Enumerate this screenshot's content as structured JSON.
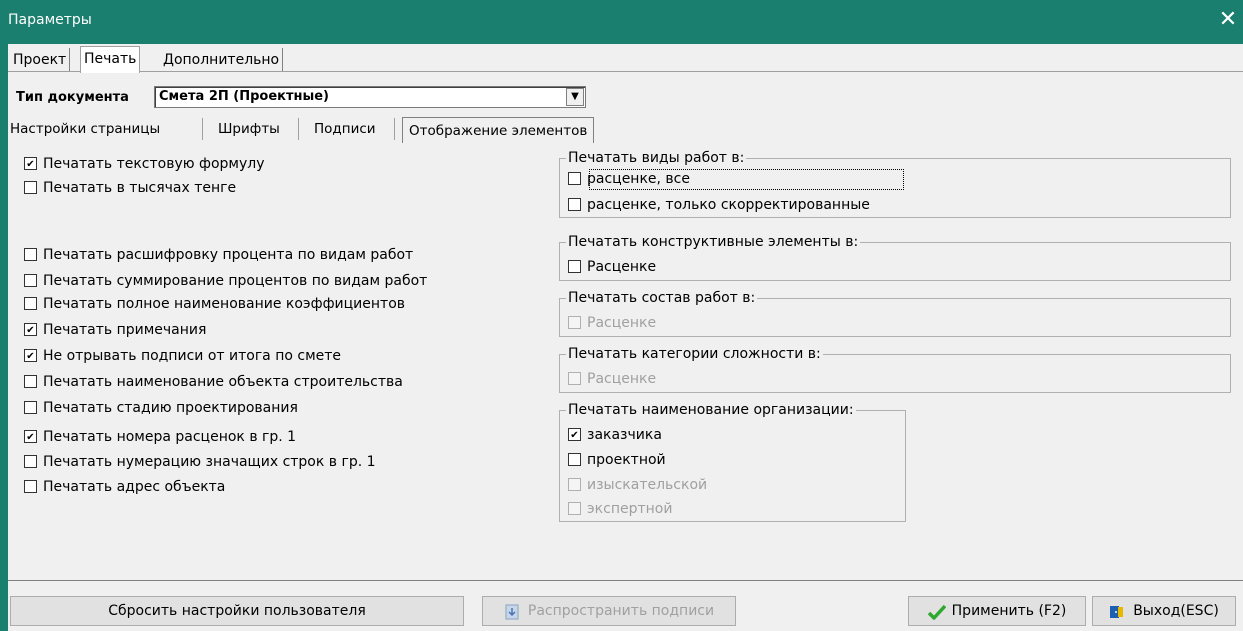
{
  "window": {
    "title": "Параметры",
    "close_icon": "close-icon"
  },
  "main_tabs": [
    "Проект",
    "Печать",
    "Дополнительно"
  ],
  "doc_type": {
    "label": "Тип документа",
    "value": "Смета 2П (Проектные)"
  },
  "sub_tabs": [
    "Настройки страницы",
    "Шрифты",
    "Подписи",
    "Отображение элементов"
  ],
  "left_options": [
    {
      "label": "Печатать текстовую формулу",
      "checked": true
    },
    {
      "label": "Печатать в тысячах тенге",
      "checked": false
    },
    {
      "label": "Печатать расшифровку процента по видам работ",
      "checked": false
    },
    {
      "label": "Печатать суммирование процентов по видам работ",
      "checked": false
    },
    {
      "label": "Печатать полное наименование коэффициентов",
      "checked": false
    },
    {
      "label": "Печатать примечания",
      "checked": true
    },
    {
      "label": "Не отрывать подписи от итога по смете",
      "checked": true
    },
    {
      "label": "Печатать наименование объекта строительства",
      "checked": false
    },
    {
      "label": "Печатать стадию проектирования",
      "checked": false
    },
    {
      "label": "Печатать номера расценок в гр. 1",
      "checked": true
    },
    {
      "label": "Печатать нумерацию значащих строк в гр. 1",
      "checked": false
    },
    {
      "label": "Печатать адрес объекта",
      "checked": false
    }
  ],
  "groups": {
    "work_types": {
      "title": "Печатать виды работ в:",
      "items": [
        {
          "label": "расценке, все",
          "checked": false,
          "disabled": false
        },
        {
          "label": "расценке, только скорректированные",
          "checked": false,
          "disabled": false
        }
      ]
    },
    "structural": {
      "title": "Печатать конструктивные элементы в:",
      "items": [
        {
          "label": "Расценке",
          "checked": false,
          "disabled": false
        }
      ]
    },
    "composition": {
      "title": "Печатать состав работ в:",
      "items": [
        {
          "label": "Расценке",
          "checked": false,
          "disabled": true
        }
      ]
    },
    "complexity": {
      "title": "Печатать категории сложности в:",
      "items": [
        {
          "label": "Расценке",
          "checked": false,
          "disabled": true
        }
      ]
    },
    "organization": {
      "title": "Печатать наименование организации:",
      "items": [
        {
          "label": "заказчика",
          "checked": true,
          "disabled": false
        },
        {
          "label": "проектной",
          "checked": false,
          "disabled": false
        },
        {
          "label": "изыскательской",
          "checked": false,
          "disabled": true
        },
        {
          "label": "экспертной",
          "checked": false,
          "disabled": true
        }
      ]
    }
  },
  "buttons": {
    "reset": "Сбросить настройки пользователя",
    "spread": "Распространить подписи",
    "apply": "Применить (F2)",
    "exit": "Выход(ESC)"
  },
  "colors": {
    "titlebar": "#1a7f6e",
    "apply_icon": "#2ea82e",
    "exit_icon": "#1f5fb0"
  }
}
